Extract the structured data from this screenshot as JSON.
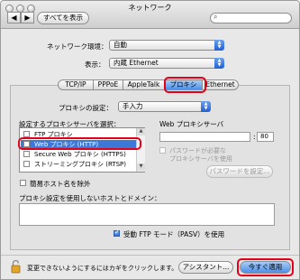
{
  "window": {
    "title": "ネットワーク"
  },
  "toolbar": {
    "show_all": "すべてを表示",
    "back": "◀",
    "forward": "▶",
    "search_placeholder": ""
  },
  "location": {
    "label": "ネットワーク環境：",
    "value": "自動"
  },
  "show": {
    "label": "表示：",
    "value": "内蔵 Ethernet"
  },
  "tabs": [
    {
      "label": "TCP/IP"
    },
    {
      "label": "PPPoE"
    },
    {
      "label": "AppleTalk"
    },
    {
      "label": "プロキシ",
      "active": true
    },
    {
      "label": "Ethernet"
    }
  ],
  "proxy_setting": {
    "label": "プロキシの設定：",
    "value": "手入力"
  },
  "proxy_list": {
    "label": "設定するプロキシサーバを選択：",
    "items": [
      {
        "label": "FTP プロキシ",
        "checked": false
      },
      {
        "label": "Web プロキシ (HTTP)",
        "checked": false,
        "selected": true
      },
      {
        "label": "Secure Web プロキシ (HTTPS)",
        "checked": false
      },
      {
        "label": "ストリーミングプロキシ (RTSP)",
        "checked": false
      }
    ]
  },
  "web_proxy": {
    "label": "Web プロキシサーバ",
    "host": "",
    "port": "80",
    "password_required": "パスワードが必要な",
    "password_required_2": "プロキシサーバを使用",
    "set_password": "パスワードを設定..."
  },
  "exclude_simple": {
    "label": "簡易ホスト名を除外",
    "checked": false
  },
  "bypass": {
    "label": "プロキシ設定を使用しないホストとドメイン：",
    "value": ""
  },
  "passive_ftp": {
    "label": "受動 FTP モード（PASV）を使用",
    "checked": true
  },
  "footer": {
    "lock_text": "変更できないようにするにはカギをクリックします。",
    "assistant": "アシスタント...",
    "apply_now": "今すぐ適用"
  },
  "colors": {
    "highlight": "#e2001a",
    "accent": "#3a7be0"
  }
}
